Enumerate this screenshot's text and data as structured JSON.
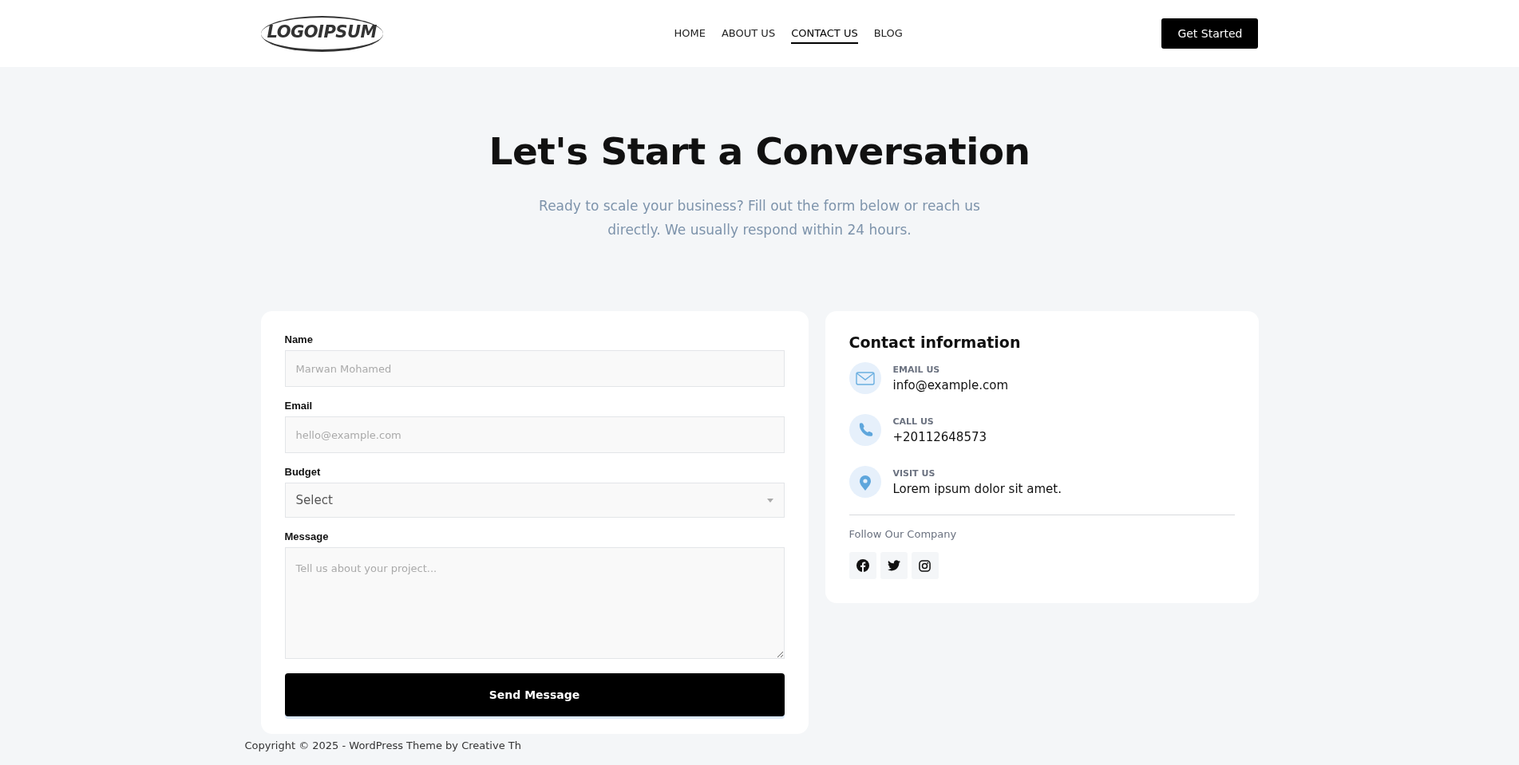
{
  "header": {
    "logo": "LOGOIPSUM",
    "nav": [
      {
        "label": "HOME",
        "selected": false
      },
      {
        "label": "ABOUT US",
        "selected": false
      },
      {
        "label": "CONTACT US",
        "selected": true
      },
      {
        "label": "BLOG",
        "selected": false
      }
    ],
    "cta": "Get Started"
  },
  "hero": {
    "title": "Let's Start a Conversation",
    "subtitle": "Ready to scale your business? Fill out the form below or reach us directly. We usually respond within 24 hours."
  },
  "form": {
    "fields": [
      {
        "kind": "text",
        "label": "Name",
        "placeholder": "Marwan Mohamed"
      },
      {
        "kind": "text",
        "label": "Email",
        "placeholder": "hello@example.com"
      },
      {
        "kind": "select",
        "label": "Budget",
        "value": "Select"
      },
      {
        "kind": "textarea",
        "label": "Message",
        "placeholder": "Tell us about your project..."
      }
    ],
    "submit": "Send Message"
  },
  "contact_info": {
    "title": "Contact information",
    "items": [
      {
        "kind": "email",
        "label": "EMAIL US",
        "value": "info@example.com"
      },
      {
        "kind": "phone",
        "label": "CALL US",
        "value": "+20112648573"
      },
      {
        "kind": "location",
        "label": "VISIT US",
        "value": "Lorem ipsum dolor sit amet."
      }
    ],
    "follow": "Follow Our Company",
    "social": [
      {
        "kind": "facebook"
      },
      {
        "kind": "twitter"
      },
      {
        "kind": "instagram"
      }
    ]
  },
  "footer": {
    "text": "Copyright © 2025 - WordPress Theme by Creative Th"
  }
}
